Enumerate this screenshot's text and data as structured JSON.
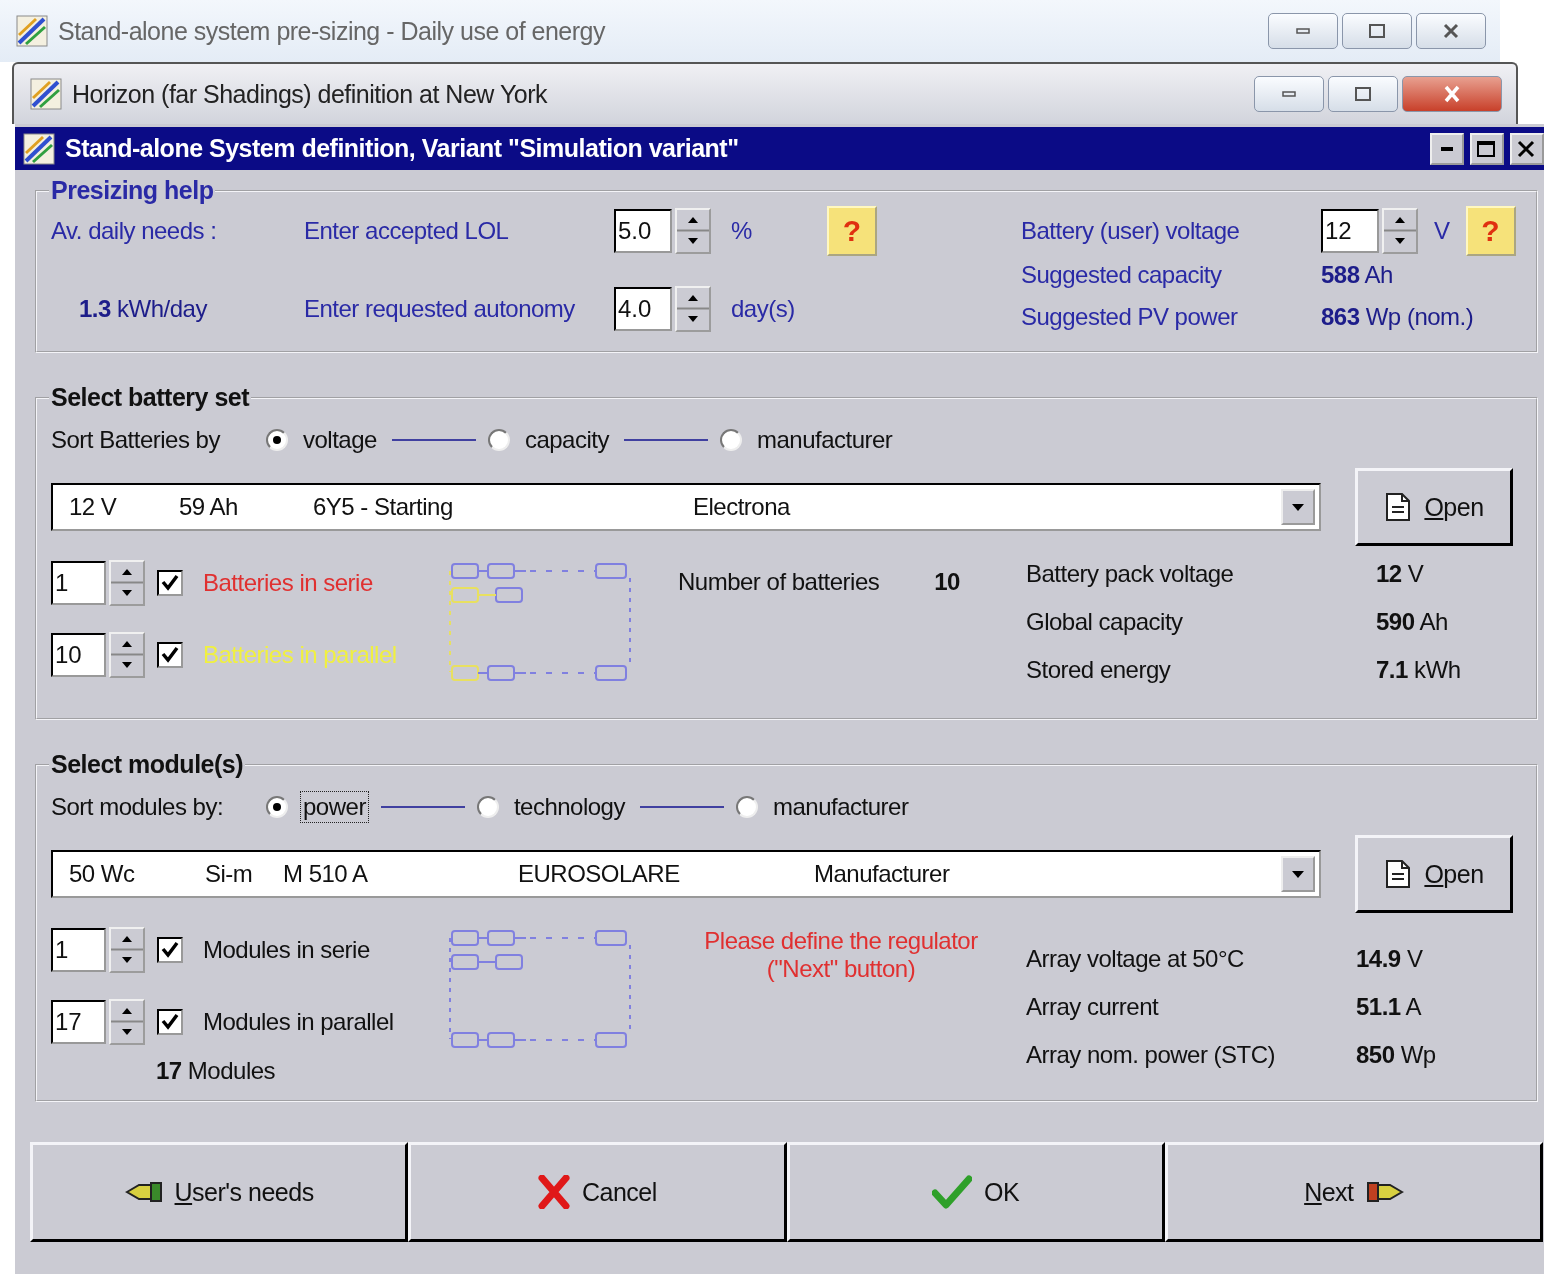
{
  "windows": [
    {
      "title": "Stand-alone system pre-sizing  -  Daily use of energy",
      "kind": "aero-light"
    },
    {
      "title": "Horizon (far Shadings) definition at New York",
      "kind": "aero"
    },
    {
      "title": "Stand-alone System definition, Variant  \"Simulation variant\"",
      "kind": "classic"
    }
  ],
  "presizing": {
    "title": "Presizing help",
    "daily_needs_label": "Av. daily needs :",
    "daily_needs": "**1.3** kWh/day",
    "lol": {
      "label": "Enter accepted LOL",
      "value": "5.0",
      "unit": "%",
      "help": "?"
    },
    "autonomy": {
      "label": "Enter requested autonomy",
      "value": "4.0",
      "unit": "day(s)"
    },
    "voltage": {
      "label": "Battery (user) voltage",
      "value": "12",
      "unit": "V",
      "help": "?"
    },
    "results": [
      {
        "label": "Suggested capacity",
        "value": "**588** Ah"
      },
      {
        "label": "Suggested PV power",
        "value": "**863** Wp (nom.)"
      }
    ]
  },
  "battery": {
    "title": "Select battery set",
    "sort_label": "Sort Batteries by",
    "sort_options": [
      {
        "label": "voltage",
        "selected": true,
        "focused": false
      },
      {
        "label": "capacity",
        "selected": false,
        "focused": false
      },
      {
        "label": "manufacturer",
        "selected": false,
        "focused": false
      }
    ],
    "selection": [
      "12 V",
      "59 Ah",
      "6Y5 - Starting",
      "Electrona"
    ],
    "open_button": "Open",
    "counts": [
      {
        "value": "1",
        "checked": true,
        "label": "Batteries in serie",
        "color": "#e03030"
      },
      {
        "value": "10",
        "checked": true,
        "label": "Batteries in parallel",
        "color": "#f0f040"
      }
    ],
    "number_label": "Number of batteries",
    "number": "10",
    "results": [
      {
        "label": "Battery pack voltage",
        "value": "**12** V"
      },
      {
        "label": "Global capacity",
        "value": "**590** Ah"
      },
      {
        "label": "Stored energy",
        "value": "**7.1** kWh"
      }
    ]
  },
  "modules": {
    "title": "Select module(s)",
    "sort_label": "Sort modules by:",
    "sort_options": [
      {
        "label": "power",
        "selected": true,
        "focused": true
      },
      {
        "label": "technology",
        "selected": false,
        "focused": false
      },
      {
        "label": "manufacturer",
        "selected": false,
        "focused": false
      }
    ],
    "selection": [
      "50 Wc",
      "Si-m",
      "M 510 A",
      "EUROSOLARE",
      "Manufacturer"
    ],
    "open_button": "Open",
    "counts": [
      {
        "value": "1",
        "checked": true,
        "label": "Modules in serie"
      },
      {
        "value": "17",
        "checked": true,
        "label": "Modules in parallel"
      }
    ],
    "total": "**17** Modules",
    "warning": "Please define the regulator\n(\"Next\" button)",
    "results": [
      {
        "label": "Array voltage at 50°C",
        "value": "**14.9** V"
      },
      {
        "label": "Array current",
        "value": "**51.1** A"
      },
      {
        "label": "Array nom. power (STC)",
        "value": "**850** Wp"
      }
    ]
  },
  "buttons": [
    {
      "label": "User's needs",
      "kind": "back"
    },
    {
      "label": "Cancel",
      "kind": "cancel"
    },
    {
      "label": "OK",
      "kind": "ok"
    },
    {
      "label": "Next",
      "kind": "next"
    }
  ]
}
